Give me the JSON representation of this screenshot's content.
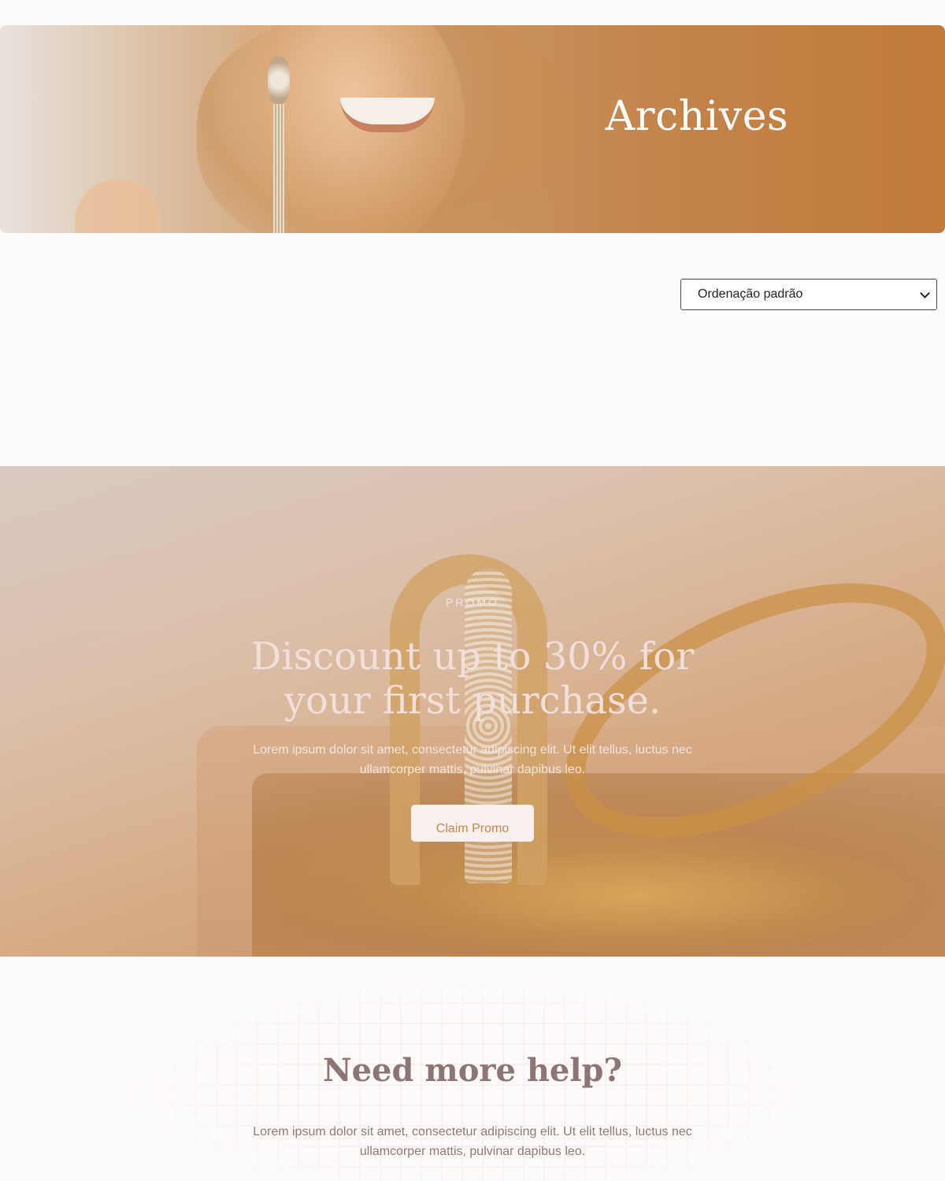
{
  "hero": {
    "title": "Archives"
  },
  "sort": {
    "selected": "Ordenação padrão"
  },
  "promo": {
    "eyebrow": "PROMO",
    "title": "Discount up to 30% for your first purchase.",
    "text": "Lorem ipsum dolor sit amet, consectetur adipiscing elit. Ut elit tellus, luctus nec ullamcorper mattis, pulvinar dapibus leo.",
    "button_label": "Claim Promo"
  },
  "help": {
    "title": "Need more help?",
    "text": "Lorem ipsum dolor sit amet, consectetur adipiscing elit. Ut elit tellus, luctus nec ullamcorper mattis, pulvinar dapibus leo."
  },
  "colors": {
    "accent": "#c07a3a",
    "background": "#fdfbfa",
    "heading_muted": "#8c7573"
  }
}
